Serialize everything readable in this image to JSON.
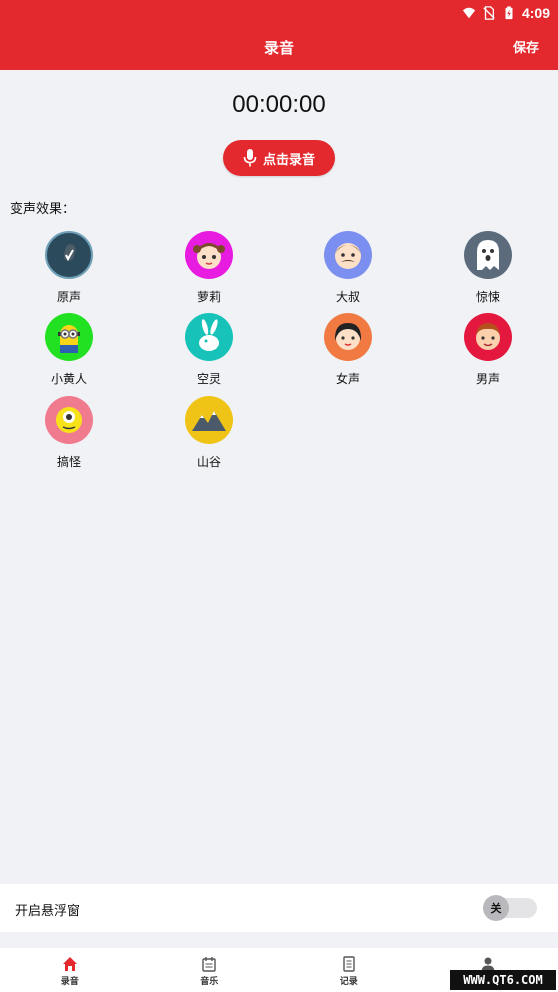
{
  "status_bar": {
    "time": "4:09"
  },
  "header": {
    "title": "录音",
    "save_label": "保存",
    "accent": "#e4292e"
  },
  "recorder": {
    "timer": "00:00:00",
    "record_label": "点击录音"
  },
  "effects": {
    "section_label": "变声效果：",
    "items": [
      {
        "label": "原声",
        "icon": "microphone-avatar-icon",
        "color": "#2b4a5c"
      },
      {
        "label": "萝莉",
        "icon": "girl-avatar-icon",
        "color": "#e81ce0"
      },
      {
        "label": "大叔",
        "icon": "uncle-avatar-icon",
        "color": "#7b8ff0"
      },
      {
        "label": "惊悚",
        "icon": "ghost-avatar-icon",
        "color": "#5b6b7b"
      },
      {
        "label": "小黄人",
        "icon": "minion-avatar-icon",
        "color": "#22e022"
      },
      {
        "label": "空灵",
        "icon": "rabbit-avatar-icon",
        "color": "#17c2b8"
      },
      {
        "label": "女声",
        "icon": "woman-avatar-icon",
        "color": "#f07a42"
      },
      {
        "label": "男声",
        "icon": "man-avatar-icon",
        "color": "#e4173e"
      },
      {
        "label": "搞怪",
        "icon": "monster-avatar-icon",
        "color": "#f07a8e"
      },
      {
        "label": "山谷",
        "icon": "mountain-avatar-icon",
        "color": "#f0c417"
      }
    ]
  },
  "floating_window": {
    "label": "开启悬浮窗",
    "toggle_state": "关"
  },
  "bottom_nav": {
    "items": [
      {
        "label": "录音",
        "icon": "home-icon",
        "active": true
      },
      {
        "label": "音乐",
        "icon": "calendar-icon",
        "active": false
      },
      {
        "label": "记录",
        "icon": "document-icon",
        "active": false
      },
      {
        "label": "",
        "icon": "person-icon",
        "active": false
      }
    ]
  },
  "watermark": "WWW.QT6.COM"
}
